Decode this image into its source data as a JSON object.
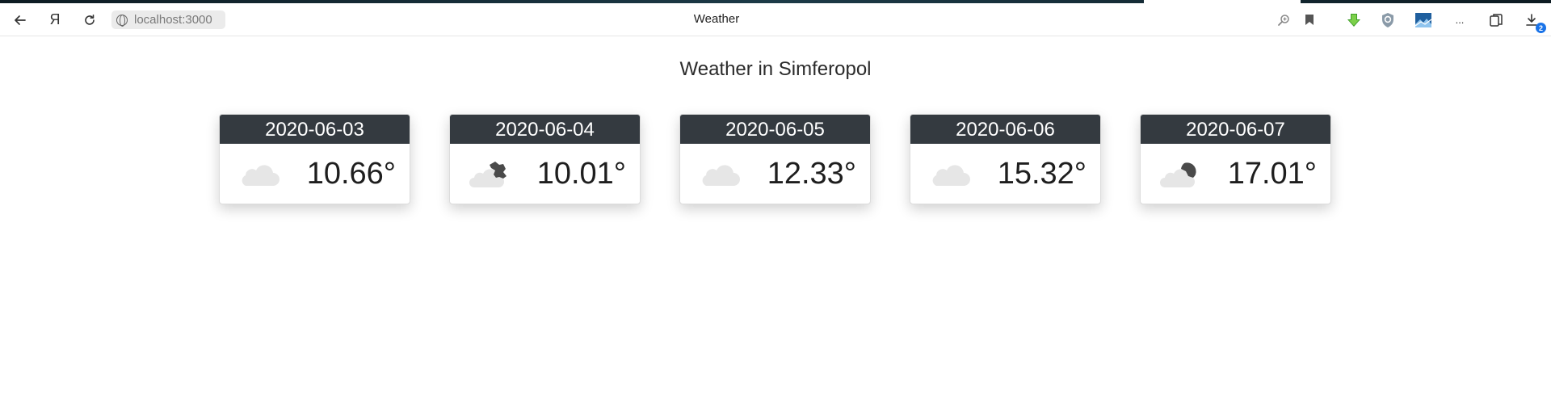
{
  "browser": {
    "url": "localhost:3000",
    "tab_title": "Weather",
    "ya_label": "Я",
    "more_label": "...",
    "download_count": "2",
    "icons": [
      "back-icon",
      "yandex-icon",
      "reload-icon",
      "globe-icon",
      "zoom-icon",
      "bookmark-icon",
      "download-extension-icon",
      "shield-icon",
      "image-extension-icon",
      "more-icon",
      "collections-icon",
      "downloads-icon"
    ]
  },
  "page": {
    "heading": "Weather in Simferopol"
  },
  "forecast": [
    {
      "date": "2020-06-03",
      "temp": "10.66°",
      "icon": "cloud-icon"
    },
    {
      "date": "2020-06-04",
      "temp": "10.01°",
      "icon": "cloud-broken-dark-icon"
    },
    {
      "date": "2020-06-05",
      "temp": "12.33°",
      "icon": "cloud-icon"
    },
    {
      "date": "2020-06-06",
      "temp": "15.32°",
      "icon": "cloud-icon"
    },
    {
      "date": "2020-06-07",
      "temp": "17.01°",
      "icon": "cloud-dark-icon"
    }
  ],
  "colors": {
    "card_header_bg": "#343a40",
    "card_header_text": "#ffffff",
    "cloud_light": "#e6e6e6",
    "cloud_dark": "#4a4a4a",
    "badge": "#1a73e8"
  }
}
